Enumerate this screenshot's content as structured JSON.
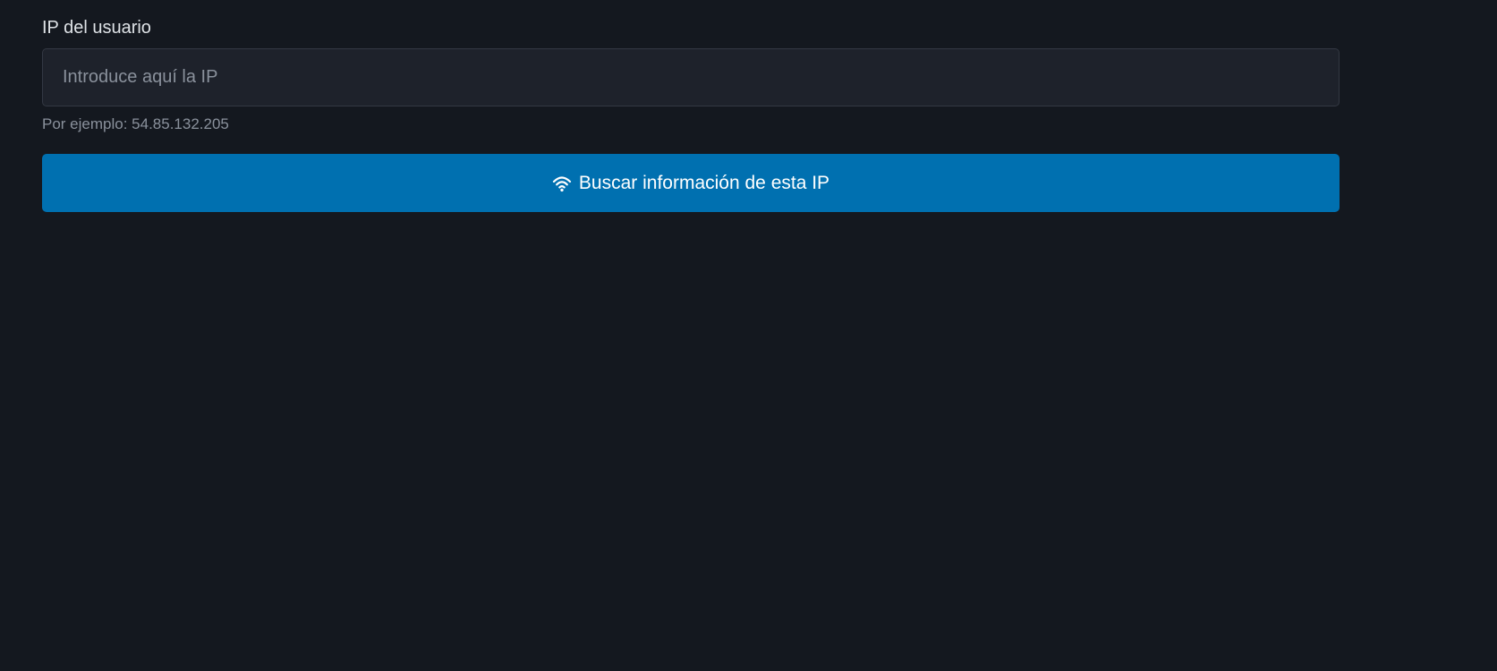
{
  "form": {
    "label": "IP del usuario",
    "input": {
      "value": "",
      "placeholder": "Introduce aquí la IP"
    },
    "help_text": "Por ejemplo: 54.85.132.205",
    "button": {
      "label": "Buscar información de esta IP",
      "icon": "wifi-icon"
    }
  },
  "colors": {
    "background": "#14181f",
    "input_background": "#1e222b",
    "button_background": "#0070b0",
    "label_text": "#dee2e6",
    "muted_text": "#8a919c"
  }
}
